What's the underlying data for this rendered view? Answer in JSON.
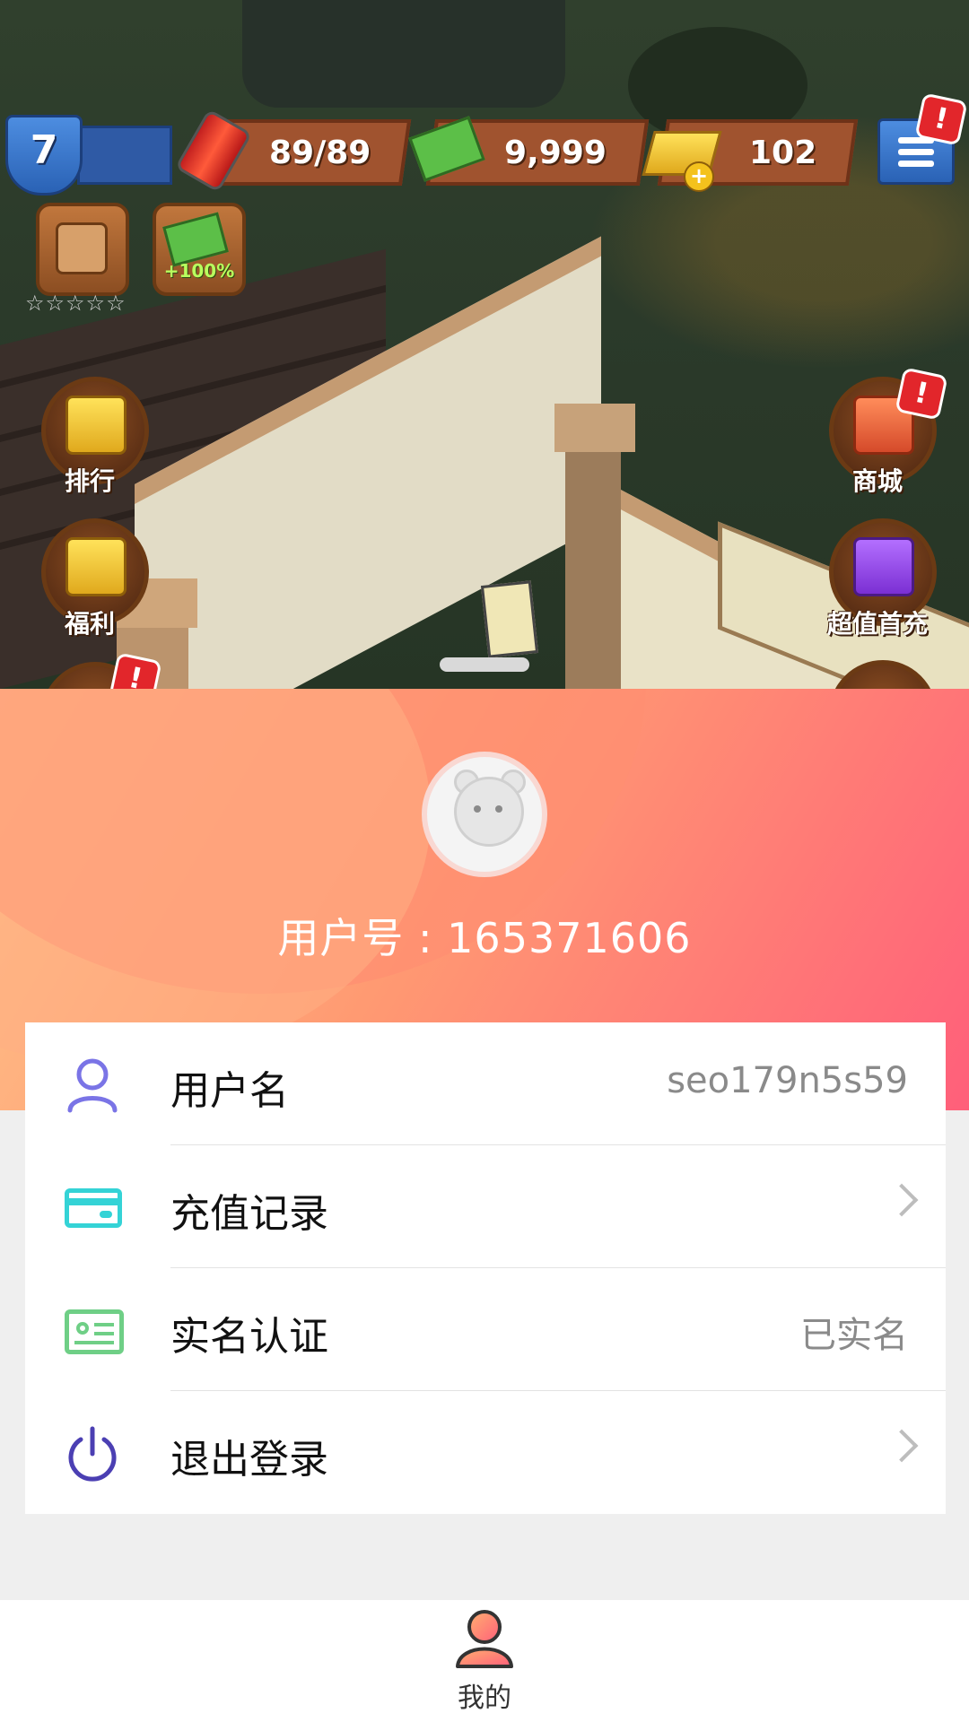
{
  "game": {
    "level": "7",
    "energy": "89/89",
    "cash": "9,999",
    "gold": "102",
    "boost_label": "+100%",
    "shop_rating": "☆☆☆☆☆",
    "buttons": {
      "ranking": "排行",
      "welfare": "福利",
      "mall": "商城",
      "first_charge": "超值首充"
    },
    "alert_mark": "!"
  },
  "profile": {
    "user_id_text": "用户号 : 165371606"
  },
  "menu": {
    "items": [
      {
        "label": "用户名",
        "value": "seo179n5s59"
      },
      {
        "label": "充值记录",
        "value": ""
      },
      {
        "label": "实名认证",
        "value": "已实名"
      },
      {
        "label": "退出登录",
        "value": ""
      }
    ]
  },
  "bottom_nav": {
    "mine_label": "我的"
  },
  "colors": {
    "accent_gradient_start": "#ffc48a",
    "accent_gradient_end": "#ff5f7a",
    "user_icon": "#7a74e6",
    "card_icon": "#34d3d6",
    "id_icon": "#6fcf86",
    "power_icon": "#4b3fb3"
  }
}
